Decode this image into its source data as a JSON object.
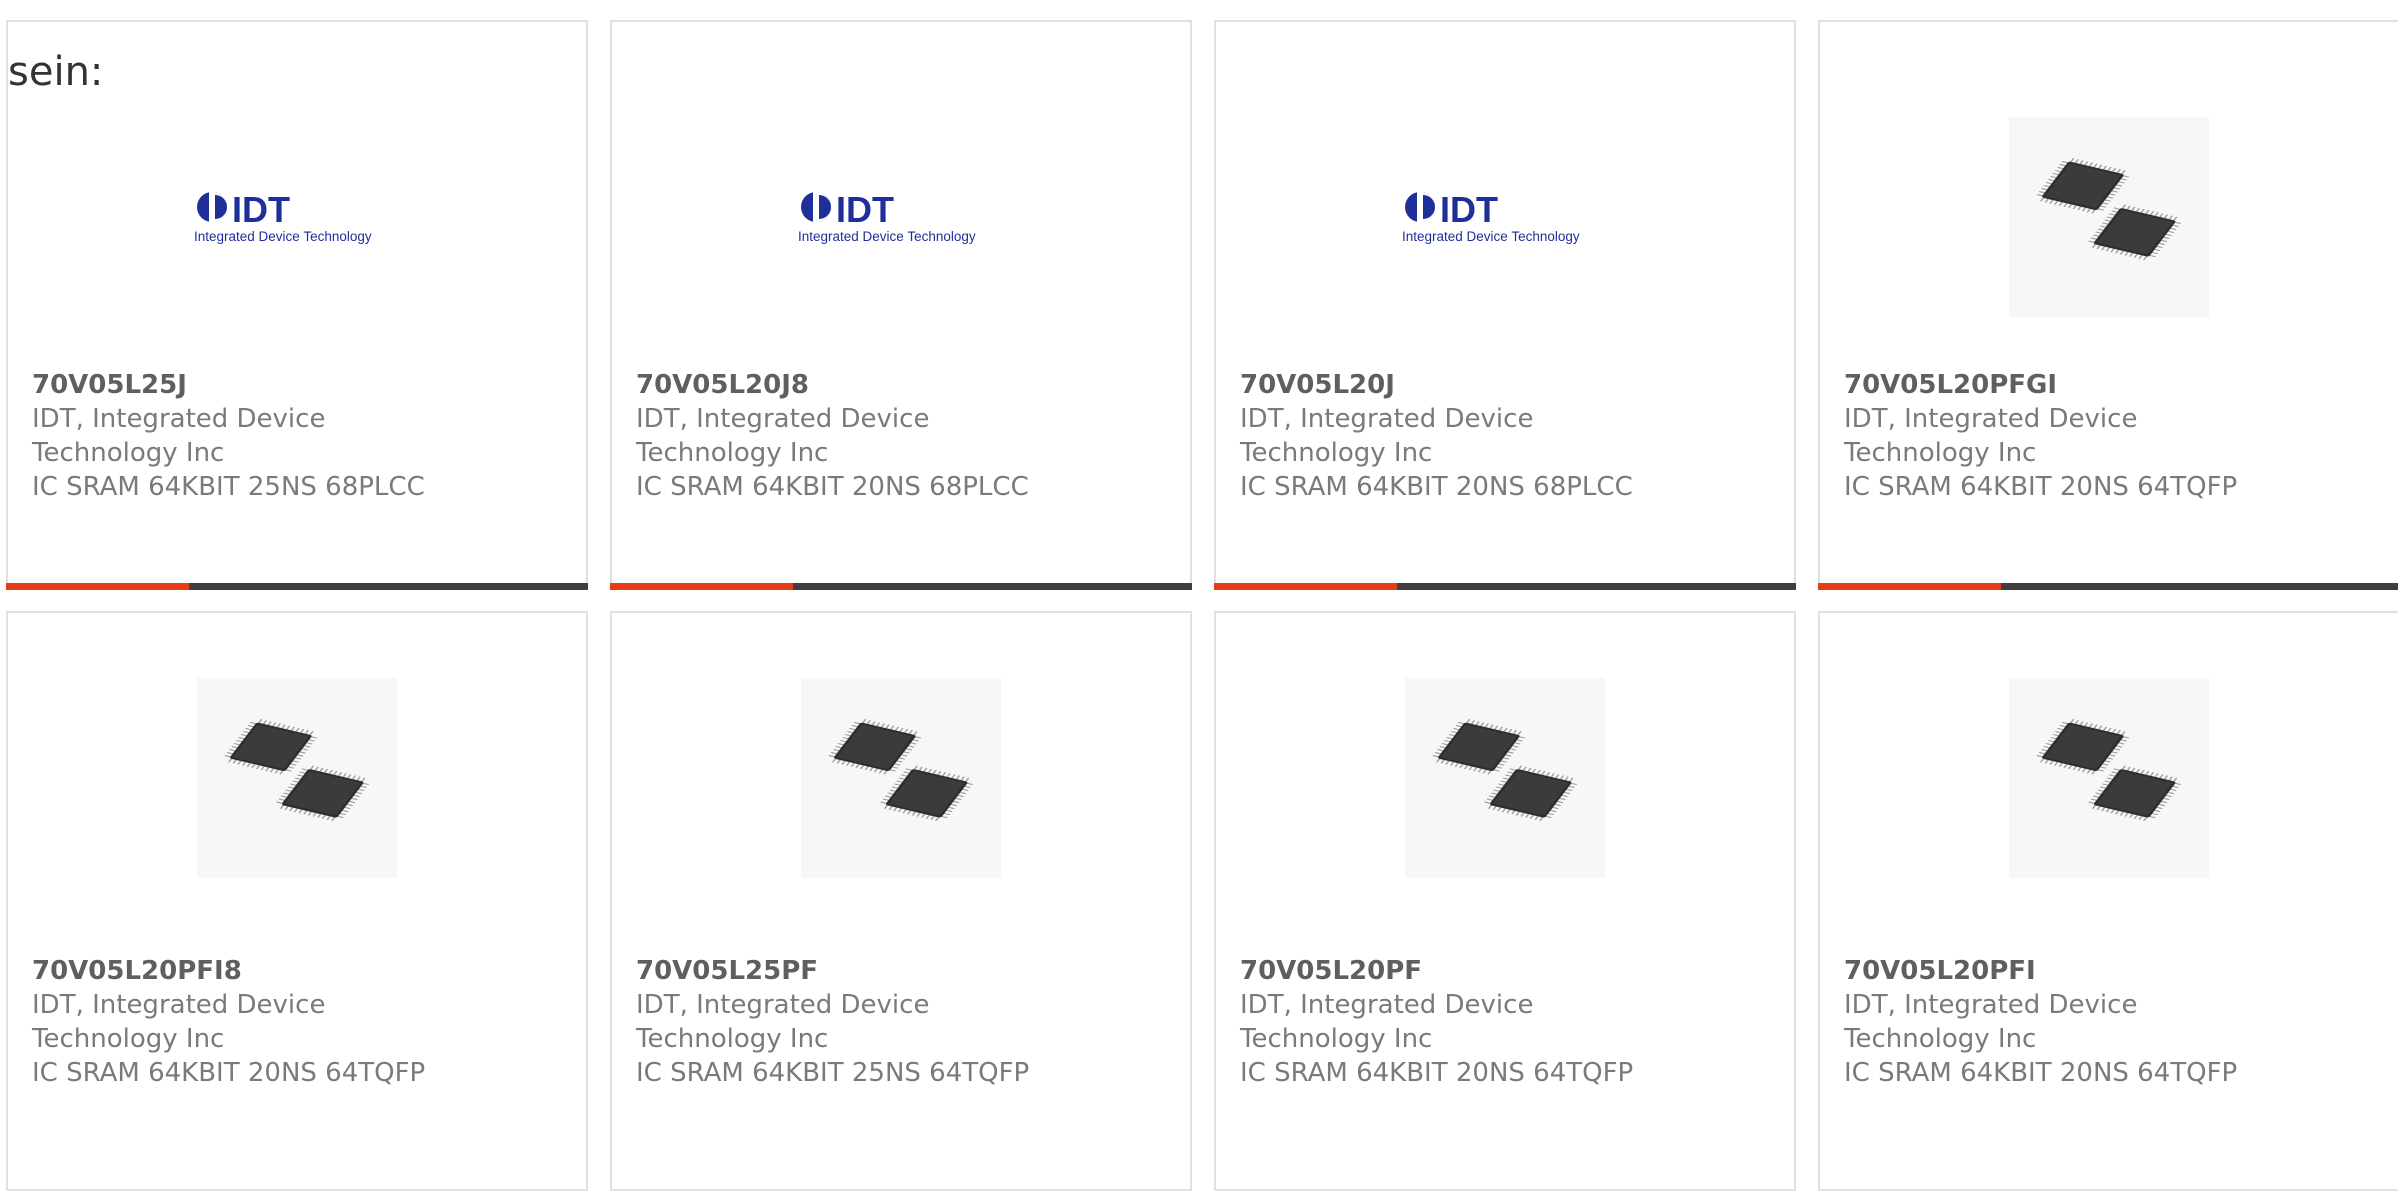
{
  "lead_text": "sein:",
  "colors": {
    "accent": "#e63e14",
    "bar": "#3f3f3f",
    "border": "#e1e1e1",
    "logo_blue": "#1f2f9a"
  },
  "logo": {
    "brand": "IDT",
    "tagline": "Integrated Device Technology"
  },
  "products": [
    {
      "part": "70V05L25J",
      "manufacturer": "IDT, Integrated Device Technology Inc",
      "description": "IC SRAM 64KBIT 25NS 68PLCC",
      "image": "idt-logo"
    },
    {
      "part": "70V05L20J8",
      "manufacturer": "IDT, Integrated Device Technology Inc",
      "description": "IC SRAM 64KBIT 20NS 68PLCC",
      "image": "idt-logo"
    },
    {
      "part": "70V05L20J",
      "manufacturer": "IDT, Integrated Device Technology Inc",
      "description": "IC SRAM 64KBIT 20NS 68PLCC",
      "image": "idt-logo"
    },
    {
      "part": "70V05L20PFGI",
      "manufacturer": "IDT, Integrated Device Technology Inc",
      "description": "IC SRAM 64KBIT 20NS 64TQFP",
      "image": "tqfp-chips"
    },
    {
      "part": "70V05L20PFI8",
      "manufacturer": "IDT, Integrated Device Technology Inc",
      "description": "IC SRAM 64KBIT 20NS 64TQFP",
      "image": "tqfp-chips"
    },
    {
      "part": "70V05L25PF",
      "manufacturer": "IDT, Integrated Device Technology Inc",
      "description": "IC SRAM 64KBIT 25NS 64TQFP",
      "image": "tqfp-chips"
    },
    {
      "part": "70V05L20PF",
      "manufacturer": "IDT, Integrated Device Technology Inc",
      "description": "IC SRAM 64KBIT 20NS 64TQFP",
      "image": "tqfp-chips"
    },
    {
      "part": "70V05L20PFI",
      "manufacturer": "IDT, Integrated Device Technology Inc",
      "description": "IC SRAM 64KBIT 20NS 64TQFP",
      "image": "tqfp-chips"
    }
  ]
}
